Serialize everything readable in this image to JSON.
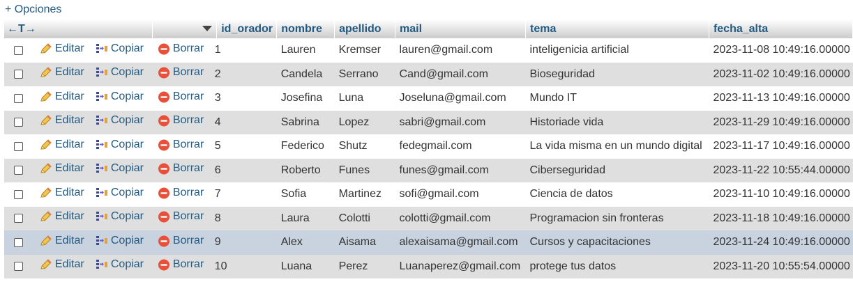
{
  "options_label": "+ Opciones",
  "header": {
    "arrows": "←T→",
    "columns": [
      "id_orador",
      "nombre",
      "apellido",
      "mail",
      "tema",
      "fecha_alta"
    ]
  },
  "actions": {
    "edit": "Editar",
    "copy": "Copiar",
    "delete": "Borrar"
  },
  "rows": [
    {
      "id": "1",
      "nombre": "Lauren",
      "apellido": "Kremser",
      "mail": "lauren@gmail.com",
      "tema": "inteligenicia artificial",
      "fecha": "2023-11-08 10:49:16.00000"
    },
    {
      "id": "2",
      "nombre": "Candela",
      "apellido": "Serrano",
      "mail": "Cand@gmail.com",
      "tema": "Bioseguridad",
      "fecha": "2023-11-02 10:49:16.00000"
    },
    {
      "id": "3",
      "nombre": "Josefina",
      "apellido": "Luna",
      "mail": "Joseluna@gmail.com",
      "tema": "Mundo IT",
      "fecha": "2023-11-13 10:49:16.00000"
    },
    {
      "id": "4",
      "nombre": "Sabrina",
      "apellido": "Lopez",
      "mail": "sabri@gmail.com",
      "tema": "Historiade vida",
      "fecha": "2023-11-29 10:49:16.00000"
    },
    {
      "id": "5",
      "nombre": "Federico",
      "apellido": "Shutz",
      "mail": "fedegmail.com",
      "tema": "La vida misma en un mundo digital",
      "fecha": "2023-11-17 10:49:16.00000"
    },
    {
      "id": "6",
      "nombre": "Roberto",
      "apellido": "Funes",
      "mail": "funes@gmail.com",
      "tema": "Ciberseguridad",
      "fecha": "2023-11-22 10:55:44.00000"
    },
    {
      "id": "7",
      "nombre": "Sofia",
      "apellido": "Martinez",
      "mail": "sofi@gmail.com",
      "tema": "Ciencia de datos",
      "fecha": "2023-11-10 10:49:16.00000"
    },
    {
      "id": "8",
      "nombre": "Laura",
      "apellido": "Colotti",
      "mail": "colotti@gmail.com",
      "tema": "Programacion sin fronteras",
      "fecha": "2023-11-18 10:49:16.00000"
    },
    {
      "id": "9",
      "nombre": "Alex",
      "apellido": "Aisama",
      "mail": "alexaisama@gmail.com",
      "tema": "Cursos y capacitaciones",
      "fecha": "2023-11-24 10:49:16.00000"
    },
    {
      "id": "10",
      "nombre": "Luana",
      "apellido": "Perez",
      "mail": "Luanaperez@gmail.com",
      "tema": "protege tus datos",
      "fecha": "2023-11-20 10:55:54.00000"
    }
  ],
  "highlighted_row": "9",
  "colors": {
    "link": "#235a81",
    "row_even": "#dfdfdf",
    "row_marked": "#c9d3e0",
    "delete_icon": "#e8503a"
  }
}
